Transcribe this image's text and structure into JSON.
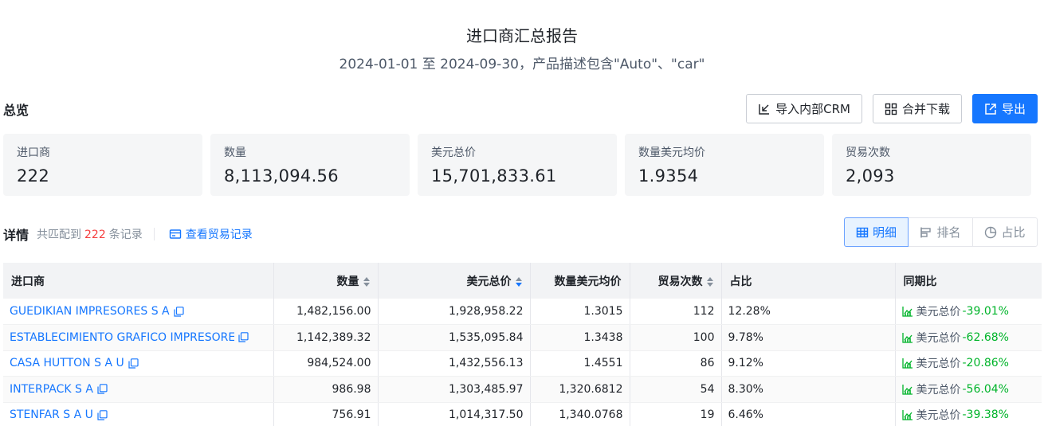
{
  "report": {
    "title": "进口商汇总报告",
    "subtitle": "2024-01-01 至 2024-09-30，产品描述包含\"Auto\"、\"car\""
  },
  "overview": {
    "label": "总览",
    "actions": [
      {
        "label": "导入内部CRM",
        "icon": "crm-import-icon"
      },
      {
        "label": "合并下载",
        "icon": "merge-download-icon"
      },
      {
        "label": "导出",
        "icon": "export-icon"
      }
    ],
    "stats": [
      {
        "label": "进口商",
        "value": "222"
      },
      {
        "label": "数量",
        "value": "8,113,094.56"
      },
      {
        "label": "美元总价",
        "value": "15,701,833.61"
      },
      {
        "label": "数量美元均价",
        "value": "1.9354"
      },
      {
        "label": "贸易次数",
        "value": "2,093"
      }
    ]
  },
  "detail": {
    "title": "详情",
    "count_prefix": "共匹配到",
    "count": "222",
    "count_suffix": "条记录",
    "view_trades_label": "查看贸易记录",
    "views": [
      {
        "label": "明细",
        "icon": "table-icon",
        "active": true
      },
      {
        "label": "排名",
        "icon": "ranking-icon",
        "active": false
      },
      {
        "label": "占比",
        "icon": "pie-icon",
        "active": false
      }
    ]
  },
  "table": {
    "columns": [
      "进口商",
      "数量",
      "美元总价",
      "数量美元均价",
      "贸易次数",
      "占比",
      "同期比"
    ],
    "rows": [
      {
        "importer": "GUEDIKIAN IMPRESORES S A",
        "qty": "1,482,156.00",
        "usd": "1,928,958.22",
        "avg": "1.3015",
        "trades": "112",
        "share": "12.28%",
        "yoy_label": "美元总价",
        "yoy": "-39.01%"
      },
      {
        "importer": "ESTABLECIMIENTO GRAFICO IMPRESORES S",
        "qty": "1,142,389.32",
        "usd": "1,535,095.84",
        "avg": "1.3438",
        "trades": "100",
        "share": "9.78%",
        "yoy_label": "美元总价",
        "yoy": "-62.68%"
      },
      {
        "importer": "CASA HUTTON S A U",
        "qty": "984,524.00",
        "usd": "1,432,556.13",
        "avg": "1.4551",
        "trades": "86",
        "share": "9.12%",
        "yoy_label": "美元总价",
        "yoy": "-20.86%"
      },
      {
        "importer": "INTERPACK S A",
        "qty": "986.98",
        "usd": "1,303,485.97",
        "avg": "1,320.6812",
        "trades": "54",
        "share": "8.30%",
        "yoy_label": "美元总价",
        "yoy": "-56.04%"
      },
      {
        "importer": "STENFAR S A U",
        "qty": "756.91",
        "usd": "1,014,317.50",
        "avg": "1,340.0768",
        "trades": "19",
        "share": "6.46%",
        "yoy_label": "美元总价",
        "yoy": "-39.38%"
      }
    ]
  },
  "colors": {
    "primary": "#1677ff",
    "positive_green": "#00b42a",
    "count_red": "#f53f3f"
  }
}
